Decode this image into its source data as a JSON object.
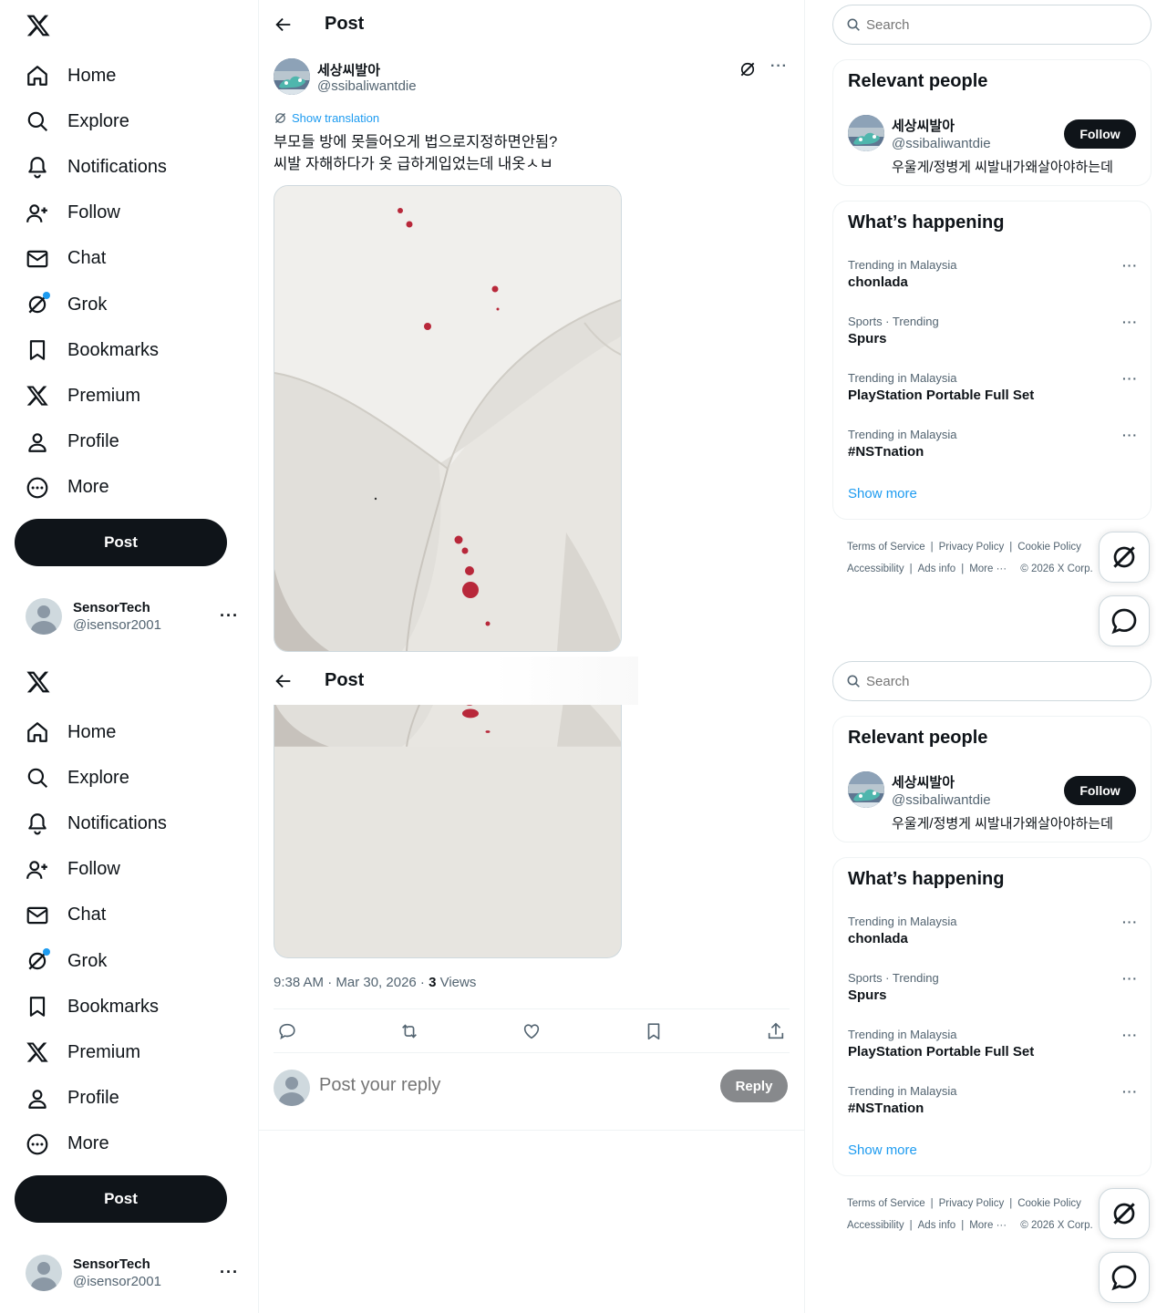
{
  "nav": {
    "items": [
      {
        "label": "Home",
        "icon": "home-icon"
      },
      {
        "label": "Explore",
        "icon": "search-icon"
      },
      {
        "label": "Notifications",
        "icon": "bell-icon"
      },
      {
        "label": "Follow",
        "icon": "follow-icon"
      },
      {
        "label": "Chat",
        "icon": "mail-icon"
      },
      {
        "label": "Grok",
        "icon": "grok-icon"
      },
      {
        "label": "Bookmarks",
        "icon": "bookmark-icon"
      },
      {
        "label": "Premium",
        "icon": "x-logo-icon"
      },
      {
        "label": "Profile",
        "icon": "profile-icon"
      },
      {
        "label": "More",
        "icon": "more-circle-icon"
      }
    ],
    "post_label": "Post"
  },
  "account": {
    "name": "SensorTech",
    "handle": "@isensor2001",
    "more": "···"
  },
  "header": {
    "title": "Post"
  },
  "post": {
    "author_name": "세상씨발아",
    "author_handle": "@ssibaliwantdie",
    "more": "···",
    "show_translation": "Show translation",
    "text_line1": "부모들 방에 못들어오게 법으로지정하면안됨?",
    "text_line2": "씨발 자해하다가 옷 급하게입었는데 내옷ㅅㅂ",
    "time": "9:38 AM · Mar 30, 2026 · ",
    "views_count": "3",
    "views_label": " Views"
  },
  "reply": {
    "placeholder": "Post your reply",
    "button": "Reply"
  },
  "search": {
    "placeholder": "Search"
  },
  "relevant": {
    "title": "Relevant people",
    "name": "세상씨발아",
    "handle": "@ssibaliwantdie",
    "bio": "우울게/정병게 씨발내가왜살아야하는데",
    "follow": "Follow"
  },
  "happening": {
    "title": "What’s happening",
    "trends": [
      {
        "context": "Trending in Malaysia",
        "name": "chonlada"
      },
      {
        "context": "Sports · Trending",
        "name": "Spurs"
      },
      {
        "context": "Trending in Malaysia",
        "name": "PlayStation Portable Full Set"
      },
      {
        "context": "Trending in Malaysia",
        "name": "#NSTnation"
      }
    ],
    "show_more": "Show more",
    "more": "···"
  },
  "footer": {
    "terms": "Terms of Service",
    "privacy": "Privacy Policy",
    "cookie": "Cookie Policy",
    "accessibility": "Accessibility",
    "ads": "Ads info",
    "more": "More ···",
    "copyright": "© 2026 X Corp."
  },
  "colors": {
    "accent": "#1d9bf0",
    "text": "#0f1419",
    "muted": "#536471",
    "button_dark": "#0f1419",
    "blood": "#b8283a"
  }
}
